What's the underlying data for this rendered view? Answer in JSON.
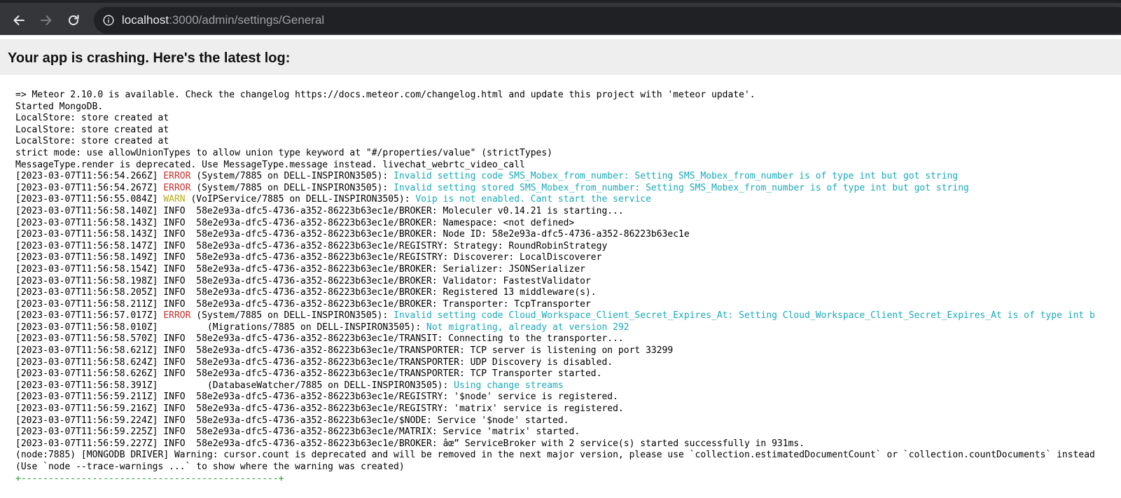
{
  "browser": {
    "url_host": "localhost",
    "url_path": ":3000/admin/settings/General"
  },
  "header": {
    "title": "Your app is crashing. Here's the latest log:"
  },
  "log": {
    "lines": [
      {
        "text": "=> Meteor 2.10.0 is available. Check the changelog https://docs.meteor.com/changelog.html and update this project with 'meteor update'."
      },
      {
        "text": "Started MongoDB."
      },
      {
        "text": "LocalStore: store created at"
      },
      {
        "text": "LocalStore: store created at"
      },
      {
        "text": "LocalStore: store created at"
      },
      {
        "text": "strict mode: use allowUnionTypes to allow union type keyword at \"#/properties/value\" (strictTypes)"
      },
      {
        "text": "MessageType.render is deprecated. Use MessageType.message instead. livechat_webrtc_video_call"
      },
      {
        "ts": "[2023-03-07T11:56:54.266Z] ",
        "level": "ERROR",
        "source": " (System/7885 on DELL-INSPIRON3505): ",
        "msg": "Invalid setting code SMS_Mobex_from_number: Setting SMS_Mobex_from_number is of type int but got string"
      },
      {
        "ts": "[2023-03-07T11:56:54.267Z] ",
        "level": "ERROR",
        "source": " (System/7885 on DELL-INSPIRON3505): ",
        "msg": "Invalid setting stored SMS_Mobex_from_number: Setting SMS_Mobex_from_number is of type int but got string"
      },
      {
        "ts": "[2023-03-07T11:56:55.084Z] ",
        "level": "WARN",
        "source": " (VoIPService/7885 on DELL-INSPIRON3505): ",
        "msg": "Voip is not enabled. Cant start the service"
      },
      {
        "text": "[2023-03-07T11:56:58.140Z] INFO  58e2e93a-dfc5-4736-a352-86223b63ec1e/BROKER: Moleculer v0.14.21 is starting..."
      },
      {
        "text": "[2023-03-07T11:56:58.143Z] INFO  58e2e93a-dfc5-4736-a352-86223b63ec1e/BROKER: Namespace: <not defined>"
      },
      {
        "text": "[2023-03-07T11:56:58.143Z] INFO  58e2e93a-dfc5-4736-a352-86223b63ec1e/BROKER: Node ID: 58e2e93a-dfc5-4736-a352-86223b63ec1e"
      },
      {
        "text": "[2023-03-07T11:56:58.147Z] INFO  58e2e93a-dfc5-4736-a352-86223b63ec1e/REGISTRY: Strategy: RoundRobinStrategy"
      },
      {
        "text": "[2023-03-07T11:56:58.149Z] INFO  58e2e93a-dfc5-4736-a352-86223b63ec1e/REGISTRY: Discoverer: LocalDiscoverer"
      },
      {
        "text": "[2023-03-07T11:56:58.154Z] INFO  58e2e93a-dfc5-4736-a352-86223b63ec1e/BROKER: Serializer: JSONSerializer"
      },
      {
        "text": "[2023-03-07T11:56:58.198Z] INFO  58e2e93a-dfc5-4736-a352-86223b63ec1e/BROKER: Validator: FastestValidator"
      },
      {
        "text": "[2023-03-07T11:56:58.205Z] INFO  58e2e93a-dfc5-4736-a352-86223b63ec1e/BROKER: Registered 13 middleware(s)."
      },
      {
        "text": "[2023-03-07T11:56:58.211Z] INFO  58e2e93a-dfc5-4736-a352-86223b63ec1e/BROKER: Transporter: TcpTransporter"
      },
      {
        "ts": "[2023-03-07T11:56:57.017Z] ",
        "level": "ERROR",
        "source": " (System/7885 on DELL-INSPIRON3505): ",
        "msg": "Invalid setting code Cloud_Workspace_Client_Secret_Expires_At: Setting Cloud_Workspace_Client_Secret_Expires_At is of type int b"
      },
      {
        "ts": "[2023-03-07T11:56:58.010Z] ",
        "level": "",
        "source": "        (Migrations/7885 on DELL-INSPIRON3505): ",
        "msg": "Not migrating, already at version 292"
      },
      {
        "text": "[2023-03-07T11:56:58.570Z] INFO  58e2e93a-dfc5-4736-a352-86223b63ec1e/TRANSIT: Connecting to the transporter..."
      },
      {
        "text": "[2023-03-07T11:56:58.621Z] INFO  58e2e93a-dfc5-4736-a352-86223b63ec1e/TRANSPORTER: TCP server is listening on port 33299"
      },
      {
        "text": "[2023-03-07T11:56:58.624Z] INFO  58e2e93a-dfc5-4736-a352-86223b63ec1e/TRANSPORTER: UDP Discovery is disabled."
      },
      {
        "text": "[2023-03-07T11:56:58.626Z] INFO  58e2e93a-dfc5-4736-a352-86223b63ec1e/TRANSPORTER: TCP Transporter started."
      },
      {
        "ts": "[2023-03-07T11:56:58.391Z] ",
        "level": "",
        "source": "        (DatabaseWatcher/7885 on DELL-INSPIRON3505): ",
        "msg": "Using change streams"
      },
      {
        "text": "[2023-03-07T11:56:59.211Z] INFO  58e2e93a-dfc5-4736-a352-86223b63ec1e/REGISTRY: '$node' service is registered."
      },
      {
        "text": "[2023-03-07T11:56:59.216Z] INFO  58e2e93a-dfc5-4736-a352-86223b63ec1e/REGISTRY: 'matrix' service is registered."
      },
      {
        "text": "[2023-03-07T11:56:59.224Z] INFO  58e2e93a-dfc5-4736-a352-86223b63ec1e/$NODE: Service '$node' started."
      },
      {
        "text": "[2023-03-07T11:56:59.225Z] INFO  58e2e93a-dfc5-4736-a352-86223b63ec1e/MATRIX: Service 'matrix' started."
      },
      {
        "text": "[2023-03-07T11:56:59.227Z] INFO  58e2e93a-dfc5-4736-a352-86223b63ec1e/BROKER: âœ” ServiceBroker with 2 service(s) started successfully in 931ms."
      },
      {
        "text": "(node:7885) [MONGODB DRIVER] Warning: cursor.count is deprecated and will be removed in the next major version, please use `collection.estimatedDocumentCount` or `collection.countDocuments` instead"
      },
      {
        "text": "(Use `node --trace-warnings ...` to show where the warning was created)"
      },
      {
        "text": "+-----------------------------------------------+",
        "kind": "box"
      }
    ]
  },
  "colors": {
    "error": "#c4312b",
    "warn": "#b6ad1b",
    "message": "#1aa9b8",
    "box": "#23a023"
  }
}
